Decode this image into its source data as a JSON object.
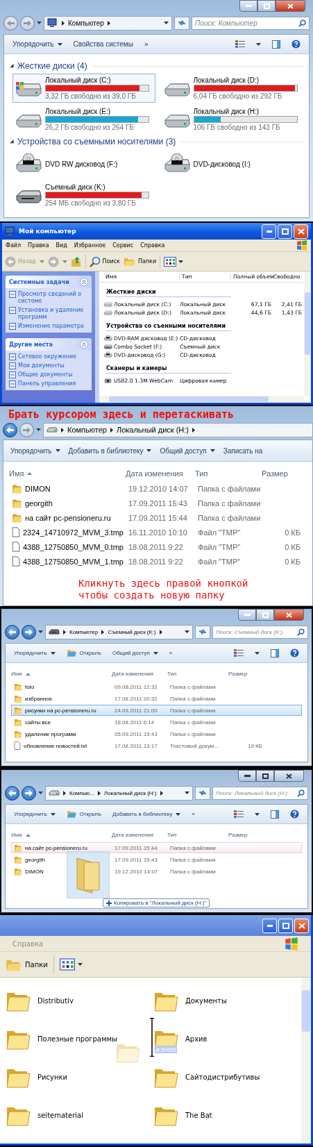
{
  "panels": [
    {
      "kind": "win7_computer",
      "caption_buttons": true,
      "window_active": true,
      "nav": {
        "back_enabled": false,
        "forward_enabled": false
      },
      "address_icon": {
        "kind": "computer"
      },
      "crumbs": [
        "Компьютер"
      ],
      "search_placeholder": "Поиск: Компьютер",
      "toolbar": [
        {
          "label": "Упорядочить",
          "kind": "menu"
        },
        {
          "label": "Свойства системы",
          "kind": "plain"
        }
      ],
      "toolbar_overflow": "»",
      "view_controls": true,
      "groups": [
        {
          "title": "Жесткие диски (4)",
          "expanded": true,
          "items": [
            {
              "name": "Локальный диск (C:)",
              "kind": "system_disk",
              "level": 0.91,
              "color": "#e41b1b",
              "free": "3,32 ГБ свободно из 39,0 ГБ",
              "selected": true
            },
            {
              "name": "Локальный диск (D:)",
              "kind": "disk",
              "level": 0.98,
              "color": "#e41b1b",
              "free": "6,04 ГБ свободно из 292 ГБ",
              "selected": false
            },
            {
              "name": "Локальный диск (E:)",
              "kind": "disk",
              "level": 0.9,
              "color": "#1aa7d0",
              "free": "26,2 ГБ свободно из 264 ГБ",
              "selected": false
            },
            {
              "name": "Локальный диск (H:)",
              "kind": "disk",
              "level": 0.26,
              "color": "#1aa7d0",
              "free": "106 ГБ свободно из 143 ГБ",
              "selected": false
            }
          ]
        },
        {
          "title": "Устройства со съемными носителями (3)",
          "expanded": true,
          "items": [
            {
              "name": "DVD RW дисковод (F:)",
              "kind": "optical",
              "selected": false
            },
            {
              "name": "DVD-дисковод (I:)",
              "kind": "optical",
              "selected": false
            },
            {
              "name": "Съемный диск (K:)",
              "kind": "removable",
              "level": 0.93,
              "color": "#e41b1b",
              "free": "254 МБ свободно из 3,80 ГБ",
              "selected": false
            }
          ]
        }
      ]
    },
    {
      "kind": "xp_computer",
      "title": "Мой компьютер",
      "menu": [
        "Файл",
        "Правка",
        "Вид",
        "Избранное",
        "Сервис",
        "Справка"
      ],
      "toolbar": {
        "back": {
          "label": "Назад",
          "disabled": true
        },
        "search": "Поиск",
        "folders": "Папки"
      },
      "tasks": [
        {
          "title": "Системные задачи",
          "links": [
            "Просмотр сведений о системе",
            "Установка и удаление программ",
            "Изменение параметра"
          ]
        },
        {
          "title": "Другие места",
          "links": [
            "Сетевое окружение",
            "Мои документы",
            "Общие документы",
            "Панель управления"
          ]
        }
      ],
      "columns": [
        "Имя",
        "Тип",
        "Полный объем",
        "Свободно"
      ],
      "groups": [
        {
          "title": "Жесткие диски",
          "rows": [
            {
              "name": "Локальный диск (C:)",
              "kind": "disk",
              "type": "Локальный диск",
              "total": "67,1 ГБ",
              "free": "2,41 ГБ"
            },
            {
              "name": "Локальный диск (D:)",
              "kind": "disk",
              "type": "Локальный диск",
              "total": "44,6 ГБ",
              "free": "1,43 ГБ"
            }
          ]
        },
        {
          "title": "Устройства со съенными носителями",
          "rows": [
            {
              "name": "DVD-RAM дисковод (E:)",
              "kind": "optical",
              "type": "CD-дисковод"
            },
            {
              "name": "Combo Socket (F:)",
              "kind": "removable",
              "type": "Съемный диск"
            },
            {
              "name": "DVD-дисковод (G:)",
              "kind": "optical",
              "type": "CD-дисковод"
            }
          ]
        },
        {
          "title": "Сканеры и камеры",
          "rows": [
            {
              "name": "USB2.0 1.3M WebCam",
              "kind": "camera",
              "type": "Цифровая камер"
            }
          ]
        }
      ]
    },
    {
      "kind": "win7_folder_zoomed",
      "banner": "Брать курсором здесь и перетаскивать",
      "nav": {
        "back_enabled": true,
        "forward_enabled": false
      },
      "address_icon": {
        "kind": "drive"
      },
      "crumbs": [
        "Компьютер",
        "Локальный диск (H:)"
      ],
      "toolbar": [
        {
          "label": "Упорядочить",
          "kind": "menu"
        },
        {
          "label": "Добавить в библиотеку",
          "kind": "menu"
        },
        {
          "label": "Общий доступ",
          "kind": "menu"
        },
        {
          "label": "Записать на",
          "kind": "plain"
        }
      ],
      "columns": [
        {
          "label": "Имя",
          "sorted": true
        },
        {
          "label": "Дата изменения",
          "sorted": false
        },
        {
          "label": "Тип",
          "sorted": false
        },
        {
          "label": "Размер",
          "sorted": false
        }
      ],
      "rows": [
        {
          "name": "DIMON",
          "kind": "folder",
          "date": "19.12.2010 14:07",
          "type": "Папка с файлами"
        },
        {
          "name": "georgith",
          "kind": "folder",
          "date": "17.09.2011 15:43",
          "type": "Папка с файлами"
        },
        {
          "name": "на сайт pc-pensioneru.ru",
          "kind": "folder",
          "date": "17.09.2011 15:44",
          "type": "Папка с файлами"
        },
        {
          "name": "2324_14710972_MVM_3.tmp",
          "kind": "file",
          "date": "16.11.2010 10:10",
          "type": "Файл \"TMP\"",
          "size": "0 КБ"
        },
        {
          "name": "4388_12750850_MVM_0.tmp",
          "kind": "file",
          "date": "18.08.2011 9:22",
          "type": "Файл \"TMP\"",
          "size": "0 КБ"
        },
        {
          "name": "4388_12750850_MVM_1.tmp",
          "kind": "file",
          "date": "18.08.2011 9:22",
          "type": "Файл \"TMP\"",
          "size": "0 КБ"
        }
      ],
      "note_lines": [
        "Кликнуть здесь правой кнопкой",
        "чтобы создать новую папку"
      ]
    },
    {
      "kind": "win7_folder",
      "caption_buttons": true,
      "window_active": true,
      "nav": {
        "back_enabled": true,
        "forward_enabled": true
      },
      "address_icon": {
        "kind": "removable"
      },
      "crumbs": [
        "Компьютер",
        "Съемный диск (K:)"
      ],
      "search_placeholder": "Поиск: Съемный диск (K:)",
      "toolbar": [
        {
          "label": "Упорядочить",
          "kind": "menu"
        },
        {
          "label": "Открыть",
          "kind": "icon"
        },
        {
          "label": "Общий доступ",
          "kind": "menu"
        }
      ],
      "toolbar_overflow": "»",
      "view_controls": true,
      "columns": [
        {
          "label": "Имя",
          "sorted": true
        },
        {
          "label": "Дата изменения",
          "sorted": false
        },
        {
          "label": "Тип",
          "sorted": false
        },
        {
          "label": "Размер",
          "sorted": false
        }
      ],
      "rows": [
        {
          "name": "foto",
          "kind": "folder",
          "date": "09.08.2011 12:32",
          "type": "Папка с файлами",
          "selected": false
        },
        {
          "name": "избранное",
          "kind": "folder",
          "date": "17.08.2011 20:32",
          "type": "Папка с файлами",
          "selected": false
        },
        {
          "name": "рисунки на pc-pensioneru.ru",
          "kind": "folder",
          "date": "24.09.2011 21:00",
          "type": "Папка с файлами",
          "selected": true
        },
        {
          "name": "сайты все",
          "kind": "folder",
          "date": "18.08.2011 6:14",
          "type": "Папка с файлами",
          "selected": false
        },
        {
          "name": "удаление программ",
          "kind": "folder",
          "date": "05.09.2011 15:43",
          "type": "Папка с файлами",
          "selected": false
        },
        {
          "name": "обновление новостей.txt",
          "kind": "file",
          "date": "17.08.2011 13:17",
          "type": "Текстовый докум...",
          "size": "19 КБ",
          "selected": false
        }
      ]
    },
    {
      "kind": "win7_folder",
      "caption_buttons": true,
      "window_active": false,
      "nav": {
        "back_enabled": true,
        "forward_enabled": true
      },
      "address_icon": {
        "kind": "drive"
      },
      "crumbs": [
        "Компью...",
        "Локальный диск (H:)"
      ],
      "search_placeholder": "Поиск: Локальный диск (H:)",
      "toolbar": [
        {
          "label": "Упорядочить",
          "kind": "menu"
        },
        {
          "label": "Открыть",
          "kind": "icon"
        },
        {
          "label": "Добавить в библиотеку",
          "kind": "menu"
        }
      ],
      "toolbar_overflow": "»",
      "view_controls": true,
      "columns": [
        {
          "label": "Имя",
          "sorted": true
        },
        {
          "label": "Дата изменения",
          "sorted": false
        },
        {
          "label": "Тип",
          "sorted": false
        },
        {
          "label": "Размер",
          "sorted": false
        }
      ],
      "rows": [
        {
          "name": "на сайт pc-pensioneru.ru",
          "kind": "folder",
          "date": "17.09.2011 15:44",
          "type": "Папка с файлами",
          "drop_target": true
        },
        {
          "name": "georgith",
          "kind": "folder",
          "date": "17.09.2011 15:43",
          "type": "Папка с файлами",
          "drop_target": false
        },
        {
          "name": "DIMON",
          "kind": "folder",
          "date": "19.12.2010 14:07",
          "type": "Папка с файлами",
          "drop_target": false
        }
      ],
      "drag": {
        "tooltip": "Копировать в \"Локальный диск (H:)\""
      }
    },
    {
      "kind": "xp_icons",
      "menu": [
        "Справка"
      ],
      "toolbar": {
        "folders": "Папки"
      },
      "items": [
        "Distributiv",
        "Документы",
        "Полезные программы",
        "Архив",
        "Рисунки",
        "Сайтодистрибутивы",
        "seitematerial",
        "The Bat"
      ],
      "rename": "азное"
    }
  ]
}
